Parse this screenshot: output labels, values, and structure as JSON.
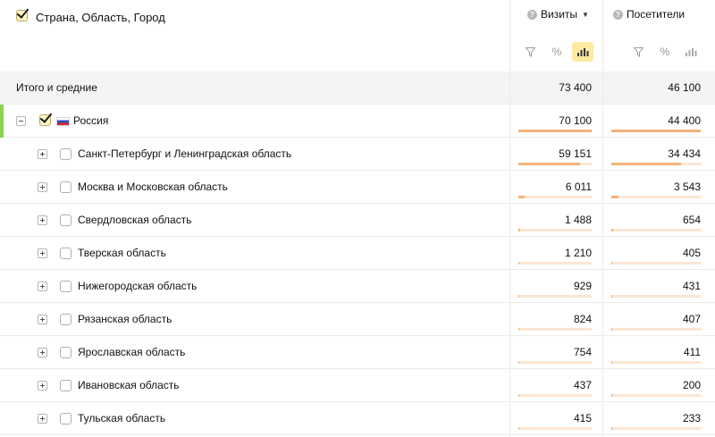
{
  "header": {
    "grouping_title": "Страна, Область, Город",
    "grouping_checked": true,
    "metrics": [
      {
        "label": "Визиты",
        "sorted": true,
        "sort_arrow": "▼",
        "help_icon": "?"
      },
      {
        "label": "Посетители",
        "sorted": false,
        "help_icon": "?"
      }
    ],
    "tools": {
      "filter_icon": "filter-icon",
      "percent_icon": "%",
      "chart_icon": "bar-chart-icon",
      "visits_chart_active": true,
      "visitors_chart_active": false
    }
  },
  "rows": [
    {
      "type": "total",
      "label": "Итого и средние",
      "visits": "73 400",
      "visitors": "46 100"
    },
    {
      "type": "country",
      "label": "Россия",
      "flag": "russia-flag-icon",
      "checked": true,
      "expanded": true,
      "visits": "70 100",
      "visitors": "44 400",
      "visits_share": 1.0,
      "visitors_share": 1.0
    },
    {
      "type": "region",
      "label": "Санкт-Петербург и Ленинградская область",
      "checked": false,
      "visits": "59 151",
      "visitors": "34 434",
      "visits_share": 0.84,
      "visitors_share": 0.78
    },
    {
      "type": "region",
      "label": "Москва и Московская область",
      "checked": false,
      "visits": "6 011",
      "visitors": "3 543",
      "visits_share": 0.086,
      "visitors_share": 0.08
    },
    {
      "type": "region",
      "label": "Свердловская область",
      "checked": false,
      "visits": "1 488",
      "visitors": "654",
      "visits_share": 0.021,
      "visitors_share": 0.015
    },
    {
      "type": "region",
      "label": "Тверская область",
      "checked": false,
      "visits": "1 210",
      "visitors": "405",
      "visits_share": 0.017,
      "visitors_share": 0.009
    },
    {
      "type": "region",
      "label": "Нижегородская область",
      "checked": false,
      "visits": "929",
      "visitors": "431",
      "visits_share": 0.013,
      "visitors_share": 0.01
    },
    {
      "type": "region",
      "label": "Рязанская область",
      "checked": false,
      "visits": "824",
      "visitors": "407",
      "visits_share": 0.012,
      "visitors_share": 0.009
    },
    {
      "type": "region",
      "label": "Ярославская область",
      "checked": false,
      "visits": "754",
      "visitors": "411",
      "visits_share": 0.011,
      "visitors_share": 0.009
    },
    {
      "type": "region",
      "label": "Ивановская область",
      "checked": false,
      "visits": "437",
      "visitors": "200",
      "visits_share": 0.006,
      "visitors_share": 0.005
    },
    {
      "type": "region",
      "label": "Тульская область",
      "checked": false,
      "visits": "415",
      "visitors": "233",
      "visits_share": 0.006,
      "visitors_share": 0.005
    }
  ],
  "colors": {
    "accent": "#8bd24d",
    "bar_track": "#fbe6d3",
    "bar_fill": "#f3b27a",
    "active_tool": "#ffe9a3",
    "total_row_bg": "#f4f4f4"
  }
}
